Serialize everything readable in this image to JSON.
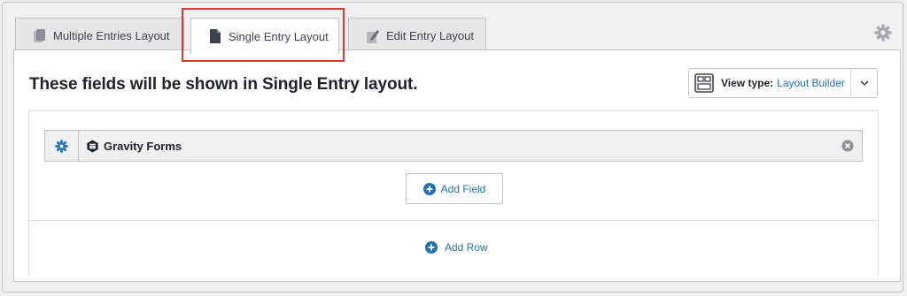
{
  "tabs": [
    {
      "label": "Multiple Entries Layout",
      "icon": "copy-icon"
    },
    {
      "label": "Single Entry Layout",
      "icon": "document-icon"
    },
    {
      "label": "Edit Entry Layout",
      "icon": "edit-icon"
    }
  ],
  "active_tab": "Single Entry Layout",
  "heading": "These fields will be shown in Single Entry layout.",
  "view_type": {
    "label": "View type:",
    "value": "Layout Builder",
    "icon": "layout-builder-icon"
  },
  "field": {
    "label": "Gravity Forms",
    "icon": "gravity-forms-icon"
  },
  "buttons": {
    "add_field": "Add Field",
    "add_row": "Add Row"
  },
  "colors": {
    "accent": "#2271b1",
    "highlight": "#e0343c",
    "background": "#f0f0f1"
  }
}
